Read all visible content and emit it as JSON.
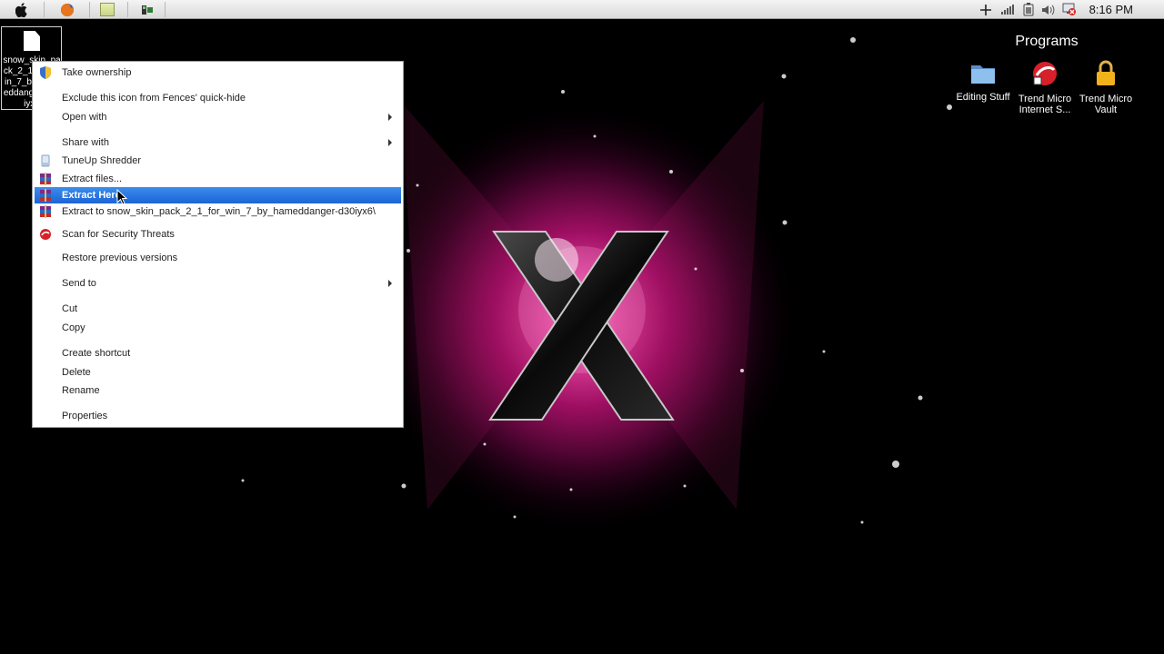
{
  "menubar": {
    "icons": [
      "apple-icon",
      "firefox-icon",
      "notes-icon",
      "app-icon"
    ],
    "tray_icons": [
      "plus-icon",
      "signal-icon",
      "battery-icon",
      "volume-icon",
      "network-error-icon"
    ],
    "clock": "8:16 PM"
  },
  "desktop": {
    "file_label": "snow_skin_pack_2_1_for_win_7_by_hameddanger-d30iyx6",
    "fence": {
      "title": "Programs",
      "items": [
        {
          "label": "Editing Stuff",
          "icon": "folder-icon"
        },
        {
          "label": "Trend Micro Internet S...",
          "icon": "trend-micro-icon"
        },
        {
          "label": "Trend Micro Vault",
          "icon": "lock-icon"
        }
      ]
    }
  },
  "context_menu": {
    "items": [
      {
        "label": "Take ownership",
        "icon": "shield-icon"
      },
      {
        "label": "Exclude this icon from Fences' quick-hide"
      },
      {
        "label": "Open with",
        "submenu": true
      },
      {
        "label": "Share with",
        "submenu": true
      },
      {
        "label": "TuneUp Shredder",
        "icon": "shredder-icon"
      },
      {
        "label": "Extract files...",
        "icon": "winrar-icon"
      },
      {
        "label": "Extract Here",
        "icon": "winrar-icon",
        "highlighted": true
      },
      {
        "label": "Extract to snow_skin_pack_2_1_for_win_7_by_hameddanger-d30iyx6\\",
        "icon": "winrar-icon"
      },
      {
        "label": "Scan for Security Threats",
        "icon": "trend-micro-icon"
      },
      {
        "label": "Restore previous versions"
      },
      {
        "label": "Send to",
        "submenu": true
      },
      {
        "label": "Cut"
      },
      {
        "label": "Copy"
      },
      {
        "label": "Create shortcut"
      },
      {
        "label": "Delete"
      },
      {
        "label": "Rename"
      },
      {
        "label": "Properties"
      }
    ]
  },
  "colors": {
    "highlight": "#1b64d6",
    "wallpaper_glow": "#c2187a"
  }
}
